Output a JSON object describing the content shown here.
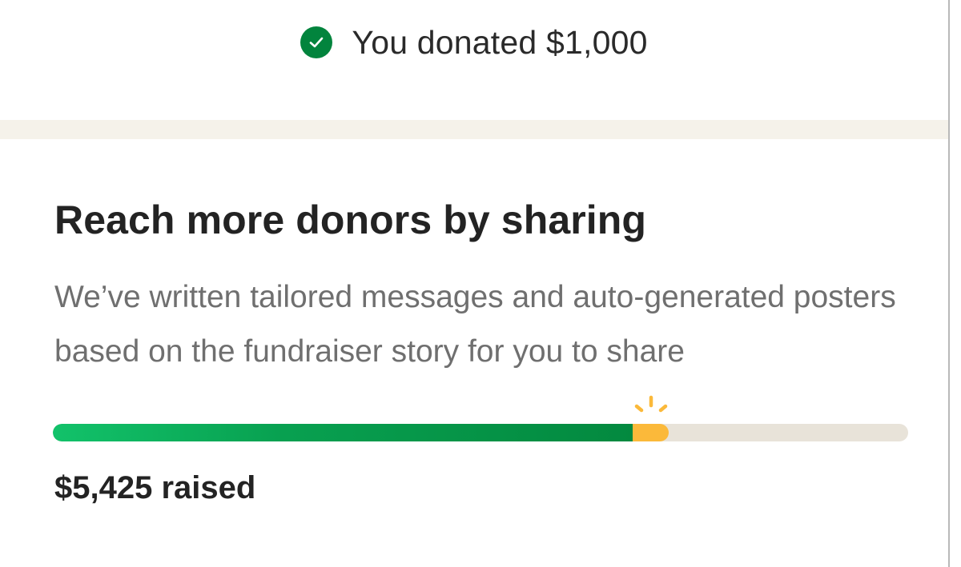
{
  "donation_confirmation": {
    "text": "You donated $1,000"
  },
  "share_section": {
    "heading": "Reach more donors by sharing",
    "description": "We’ve written tailored messages and auto-generated posters based on the fundraiser story for you to share"
  },
  "progress": {
    "previous_fraction": 0.678,
    "new_fraction": 0.042,
    "raised_label": "$5,425 raised"
  },
  "colors": {
    "brand_green": "#02843d",
    "new_donation_yellow": "#fbb93a",
    "track": "#e8e3d9"
  },
  "icons": {
    "confirmation": "check-circle-icon",
    "highlight": "sparkle-icon"
  }
}
